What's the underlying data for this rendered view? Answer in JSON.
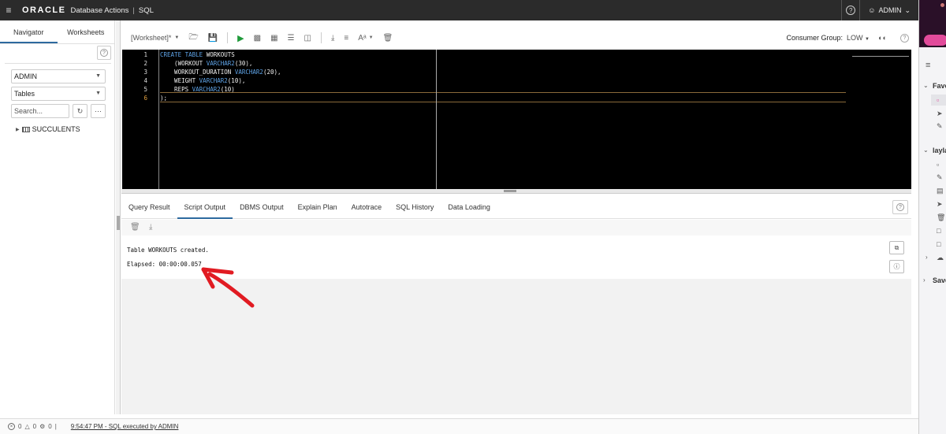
{
  "topbar": {
    "logo": "ORACLE",
    "app_title": "Database Actions",
    "separator": "|",
    "section": "SQL",
    "help": "?",
    "user": "ADMIN"
  },
  "navigator": {
    "tabs": [
      "Navigator",
      "Worksheets"
    ],
    "schema": "ADMIN",
    "object_type": "Tables",
    "search_placeholder": "Search...",
    "tree_items": [
      "SUCCULENTS"
    ]
  },
  "toolbar": {
    "worksheet": "[Worksheet]*",
    "consumer_group_label": "Consumer Group:",
    "consumer_group_value": "LOW",
    "run_color": "#1f9a3a"
  },
  "editor": {
    "line_numbers": [
      "1",
      "2",
      "3",
      "4",
      "5",
      "6"
    ],
    "lines": [
      {
        "pre": "",
        "kw": "CREATE TABLE",
        "post": " WORKOUTS"
      },
      {
        "pre": "    (WORKOUT ",
        "kw": "VARCHAR2",
        "post": "(30),"
      },
      {
        "pre": "    WORKOUT_DURATION ",
        "kw": "VARCHAR2",
        "post": "(20),"
      },
      {
        "pre": "    WEIGHT ",
        "kw": "VARCHAR2",
        "post": "(10),"
      },
      {
        "pre": "    REPS ",
        "kw": "VARCHAR2",
        "post": "(10)"
      },
      {
        "pre": ");",
        "kw": "",
        "post": ""
      }
    ],
    "keyword_color": "#5fa4e8"
  },
  "output_tabs": [
    "Query Result",
    "Script Output",
    "DBMS Output",
    "Explain Plan",
    "Autotrace",
    "SQL History",
    "Data Loading"
  ],
  "active_output_tab": "Script Output",
  "output": {
    "line1": "Table WORKOUTS created.",
    "line2": "Elapsed: 00:00:00.057"
  },
  "statusbar": {
    "errors": "0",
    "warnings": "0",
    "info": "0",
    "divider": "|",
    "message": "9:54:47 PM - SQL executed by ADMIN"
  },
  "right_strip": {
    "labels": [
      "Favo",
      "layla",
      "Save"
    ]
  },
  "annotation_color": "#e11b22"
}
